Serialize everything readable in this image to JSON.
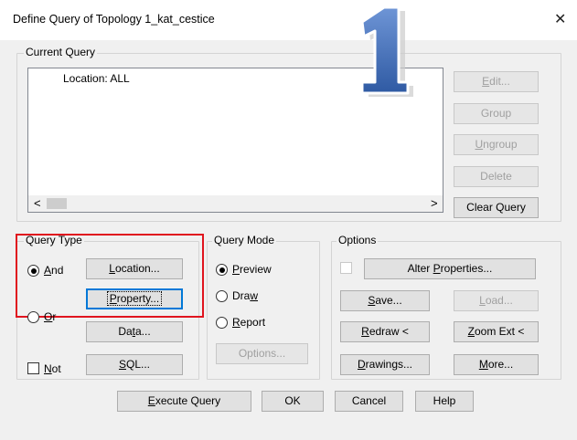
{
  "window": {
    "title": "Define Query of Topology 1_kat_cestice",
    "close": "✕"
  },
  "current_query": {
    "legend": "Current Query",
    "items": [
      "Location: ALL"
    ],
    "buttons": {
      "edit": "Edit...",
      "group": "Group",
      "ungroup": "Ungroup",
      "delete": "Delete",
      "clear": "Clear Query"
    },
    "scroll_left": "<",
    "scroll_right": ">"
  },
  "overlay_number": "1",
  "query_type": {
    "legend": "Query Type",
    "and": "And",
    "or": "Or",
    "not": "Not",
    "selected": "And",
    "buttons": {
      "location": "Location...",
      "property": "Property...",
      "data": "Data...",
      "sql": "SQL..."
    }
  },
  "query_mode": {
    "legend": "Query Mode",
    "preview": "Preview",
    "draw": "Draw",
    "report": "Report",
    "selected": "Preview",
    "options_button": "Options..."
  },
  "options": {
    "legend": "Options",
    "alter_properties": "Alter Properties...",
    "save": "Save...",
    "load": "Load...",
    "redraw": "Redraw <",
    "zoom_ext": "Zoom Ext <",
    "drawings": "Drawings...",
    "more": "More..."
  },
  "footer": {
    "execute": "Execute Query",
    "ok": "OK",
    "cancel": "Cancel",
    "help": "Help"
  },
  "colors": {
    "highlight_box": "#e0141e",
    "overlay_number": "#3f6db5"
  }
}
